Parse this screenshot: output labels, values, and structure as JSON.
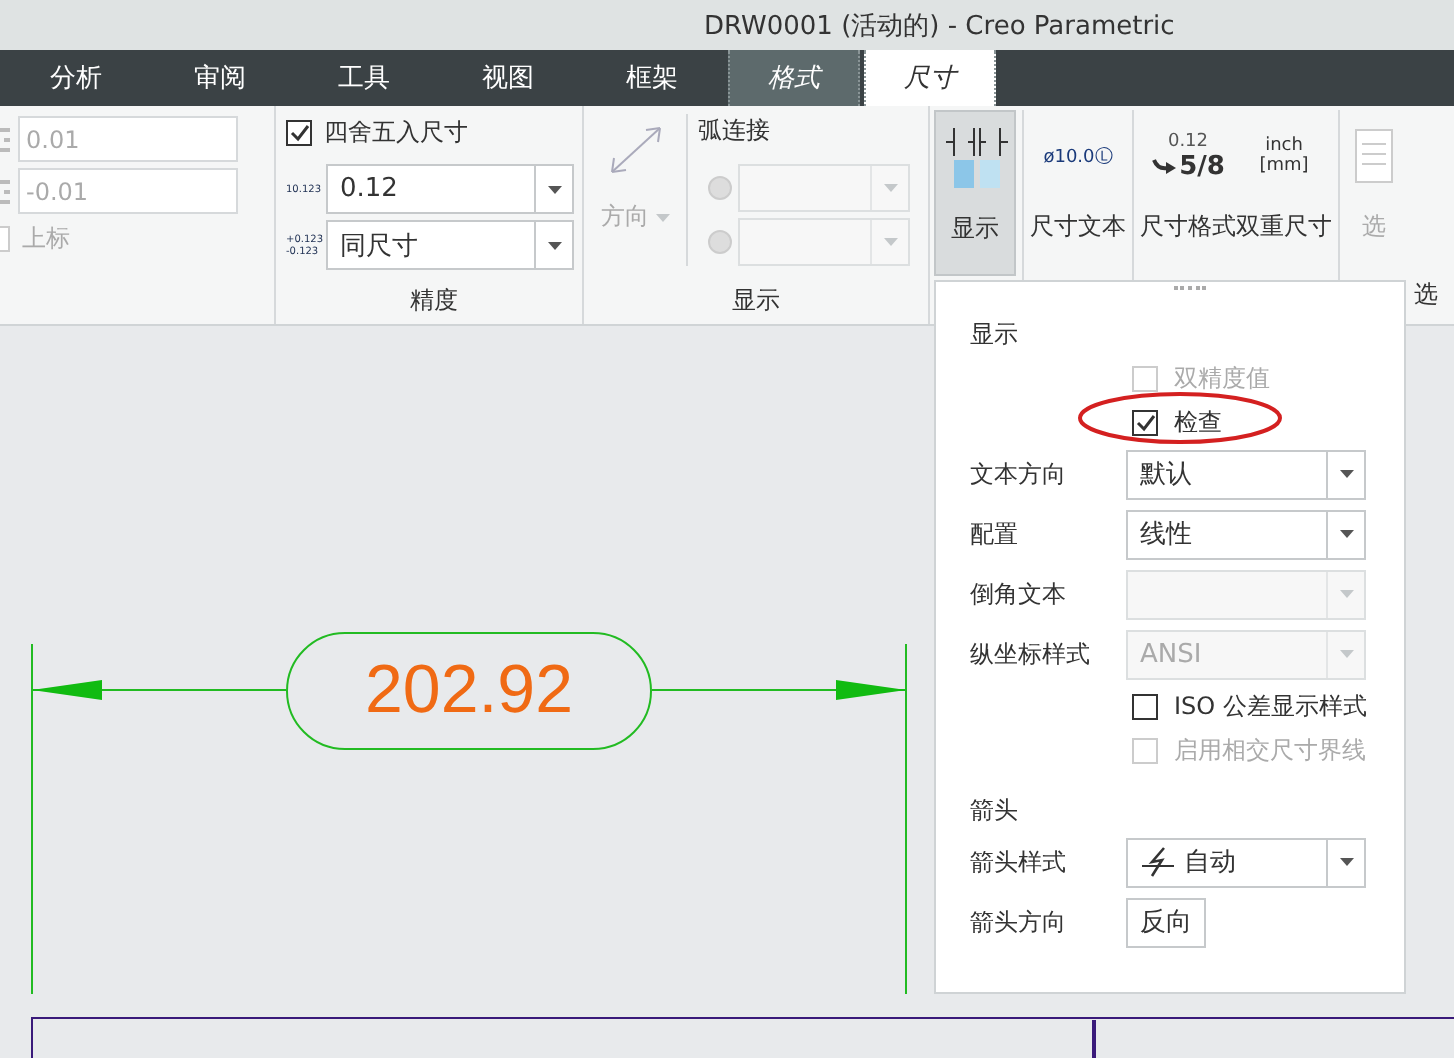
{
  "window": {
    "title": "DRW0001 (活动的) - Creo Parametric"
  },
  "menu_tabs": [
    {
      "label": "分析",
      "kind": "standard",
      "selected": false
    },
    {
      "label": "审阅",
      "kind": "standard",
      "selected": false
    },
    {
      "label": "工具",
      "kind": "standard",
      "selected": false
    },
    {
      "label": "视图",
      "kind": "standard",
      "selected": false
    },
    {
      "label": "框架",
      "kind": "standard",
      "selected": false
    },
    {
      "label": "格式",
      "kind": "contextual",
      "selected": false
    },
    {
      "label": "尺寸",
      "kind": "contextual",
      "selected": true
    }
  ],
  "ribbon": {
    "tolerance": {
      "fields": [
        {
          "value": "0.01",
          "disabled": true
        },
        {
          "value": "-0.01",
          "disabled": true
        }
      ],
      "superscript": {
        "label": "上标",
        "checked": false,
        "disabled": true
      }
    },
    "precision": {
      "round": {
        "label": "四舍五入尺寸",
        "checked": true
      },
      "dropdowns": [
        {
          "icon_text": [
            "10.123"
          ],
          "value": "0.12"
        },
        {
          "icon_text": [
            "+0.123",
            "-0.123"
          ],
          "value": "同尺寸"
        }
      ],
      "label": "精度"
    },
    "display": {
      "direction": {
        "label": "方向",
        "disabled": true
      },
      "arc_label": "弧连接",
      "arc_rows": [
        {
          "selected": false,
          "disabled": true
        },
        {
          "selected": false,
          "disabled": true
        }
      ],
      "label": "显示"
    },
    "buttons": [
      {
        "kind": "display",
        "label": "显示",
        "pressed": true,
        "disabled": false
      },
      {
        "kind": "text",
        "label": "尺寸文本",
        "icon_text": [
          "ø10.0Ⓛ"
        ],
        "pressed": false,
        "disabled": false
      },
      {
        "kind": "format",
        "label": "尺寸格式",
        "icon_text": [
          "0.12",
          "5/8"
        ],
        "pressed": false,
        "disabled": false
      },
      {
        "kind": "dual",
        "label": "双重尺寸",
        "icon_text": [
          "inch",
          "[mm]"
        ],
        "pressed": false,
        "disabled": false
      },
      {
        "kind": "options",
        "label": "选",
        "pressed": false,
        "disabled": true
      }
    ],
    "cut_group_label": "选"
  },
  "drawing": {
    "dimension": "202.92"
  },
  "panel": {
    "items": [
      {
        "kind": "heading",
        "label": "显示"
      },
      {
        "kind": "checkbox",
        "label": "双精度值",
        "checked": false,
        "disabled": true,
        "highlighted": false
      },
      {
        "kind": "checkbox",
        "label": "检查",
        "checked": true,
        "disabled": false,
        "highlighted": true
      },
      {
        "kind": "dropdown",
        "label": "文本方向",
        "value": "默认",
        "disabled": false
      },
      {
        "kind": "dropdown",
        "label": "配置",
        "value": "线性",
        "disabled": false
      },
      {
        "kind": "dropdown",
        "label": "倒角文本",
        "disabled": true
      },
      {
        "kind": "dropdown",
        "label": "纵坐标样式",
        "value": "ANSI",
        "disabled": true
      },
      {
        "kind": "checkbox",
        "label": "ISO 公差显示样式",
        "checked": false,
        "disabled": false,
        "highlighted": false
      },
      {
        "kind": "checkbox",
        "label": "启用相交尺寸界线",
        "checked": false,
        "disabled": true,
        "highlighted": false
      },
      {
        "kind": "heading",
        "label": "箭头"
      },
      {
        "kind": "dropdown",
        "label": "箭头样式",
        "value": "自动",
        "disabled": false,
        "icon": true
      },
      {
        "kind": "button",
        "label": "箭头方向",
        "button": "反向"
      }
    ]
  }
}
